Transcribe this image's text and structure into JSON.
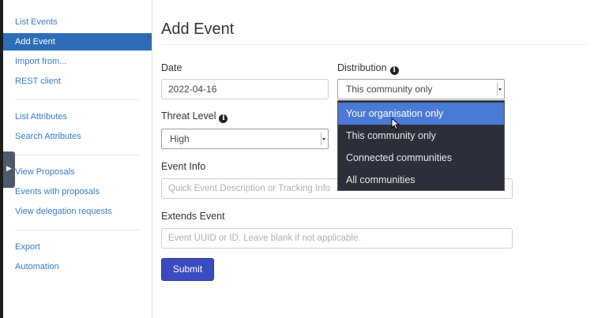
{
  "sidebar": {
    "items": [
      {
        "label": "List Events"
      },
      {
        "label": "Add Event"
      },
      {
        "label": "Import from..."
      },
      {
        "label": "REST client"
      },
      {
        "label": "List Attributes"
      },
      {
        "label": "Search Attributes"
      },
      {
        "label": "View Proposals"
      },
      {
        "label": "Events with proposals"
      },
      {
        "label": "View delegation requests"
      },
      {
        "label": "Export"
      },
      {
        "label": "Automation"
      }
    ]
  },
  "form": {
    "title": "Add Event",
    "date_label": "Date",
    "date_value": "2022-04-16",
    "distribution_label": "Distribution",
    "distribution_value": "This community only",
    "threat_level_label": "Threat Level",
    "threat_level_value": "High",
    "event_info_label": "Event Info",
    "event_info_placeholder": "Quick Event Description or Tracking Info",
    "extends_label": "Extends Event",
    "extends_placeholder": "Event UUID or ID. Leave blank if not applicable.",
    "submit_label": "Submit"
  },
  "distribution_options": [
    {
      "label": "Your organisation only",
      "highlighted": true
    },
    {
      "label": "This community only"
    },
    {
      "label": "Connected communities"
    },
    {
      "label": "All communities"
    }
  ],
  "icons": {
    "info": "info-circle-icon",
    "handle": "collapse-arrow-icon"
  },
  "colors": {
    "sidebar_active": "#2d6db7",
    "link": "#3a7bc6",
    "submit": "#3a4bc0",
    "dropdown_bg": "#2c2f3a",
    "dropdown_highlight": "#4b79d6"
  }
}
